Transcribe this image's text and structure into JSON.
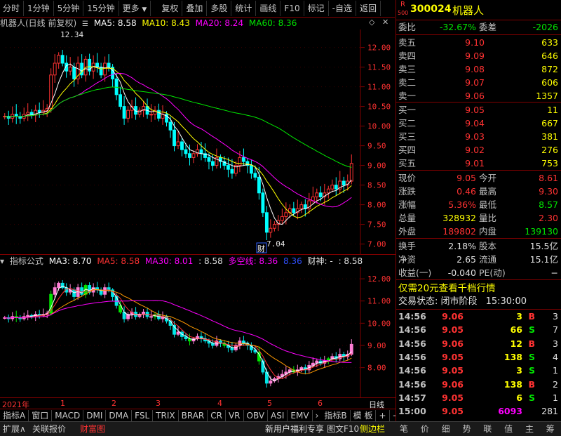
{
  "toolbar": {
    "items": [
      "分时",
      "1分钟",
      "5分钟",
      "15分钟",
      "更多",
      "复权",
      "叠加",
      "多股",
      "统计",
      "画线",
      "F10",
      "标记",
      "-自选",
      "返回"
    ],
    "symbol_icon": "down-arrow-icon"
  },
  "main_chart": {
    "title": "机器人(日线 前复权)",
    "ma5": "MA5: 8.58",
    "ma10": "MA10: 8.43",
    "ma20": "MA20: 8.24",
    "ma60": "MA60: 8.36",
    "high_label": "12.34",
    "low_label": "7.04",
    "cai_tag": "财",
    "y_ticks": [
      "12.00",
      "11.50",
      "11.00",
      "10.50",
      "10.00",
      "9.50",
      "9.00",
      "8.50",
      "8.00",
      "7.50",
      "7.00"
    ]
  },
  "sub_chart": {
    "title": "指标公式",
    "ma3": "MA3: 8.70",
    "ma5": "MA5: 8.58",
    "ma30": "MA30: 8.01",
    "v1": ": 8.58",
    "dkx": "多空线: 8.36",
    "v2": "8.36",
    "cs": "财神: -",
    "v3": ": 8.58",
    "y_ticks": [
      "12.00",
      "11.00",
      "10.00",
      "9.00",
      "8.00"
    ]
  },
  "time_axis": {
    "labels": [
      "2021年",
      "1",
      "2",
      "3",
      "4",
      "5",
      "6"
    ],
    "period": "日线"
  },
  "bottom_tabs": [
    "指标A",
    "窗口",
    "MACD",
    "DMI",
    "DMA",
    "FSL",
    "TRIX",
    "BRAR",
    "CR",
    "VR",
    "OBV",
    "ASI",
    "EMV"
  ],
  "bottom_tabs_right": [
    "指标B",
    "模 板",
    "+",
    "−"
  ],
  "status_bar": {
    "left": [
      "扩展∧",
      "关联报价",
      "财富图"
    ],
    "ad": "新用户福利专享",
    "f10": "图文F10",
    "side": "侧边栏",
    "tabs": [
      "笔",
      "价",
      "细",
      "势",
      "联",
      "值",
      "主",
      "筹"
    ]
  },
  "quote": {
    "code": "300024",
    "name": "机器人",
    "badge_r": "R",
    "badge_num": "500",
    "weibi_label": "委比",
    "weibi": "-32.67%",
    "weicha_label": "委差",
    "weicha": "-2026",
    "sells": [
      {
        "label": "卖五",
        "price": "9.10",
        "vol": "633"
      },
      {
        "label": "卖四",
        "price": "9.09",
        "vol": "646"
      },
      {
        "label": "卖三",
        "price": "9.08",
        "vol": "872"
      },
      {
        "label": "卖二",
        "price": "9.07",
        "vol": "606"
      },
      {
        "label": "卖一",
        "price": "9.06",
        "vol": "1357"
      }
    ],
    "buys": [
      {
        "label": "买一",
        "price": "9.05",
        "vol": "11"
      },
      {
        "label": "买二",
        "price": "9.04",
        "vol": "667"
      },
      {
        "label": "买三",
        "price": "9.03",
        "vol": "381"
      },
      {
        "label": "买四",
        "price": "9.02",
        "vol": "276"
      },
      {
        "label": "买五",
        "price": "9.01",
        "vol": "753"
      }
    ],
    "stats": [
      {
        "l1": "现价",
        "v1": "9.05",
        "c1": "red",
        "l2": "今开",
        "v2": "8.61",
        "c2": "red"
      },
      {
        "l1": "涨跌",
        "v1": "0.46",
        "c1": "red",
        "l2": "最高",
        "v2": "9.30",
        "c2": "red"
      },
      {
        "l1": "涨幅",
        "v1": "5.36%",
        "c1": "red",
        "l2": "最低",
        "v2": "8.57",
        "c2": "grn"
      },
      {
        "l1": "总量",
        "v1": "328932",
        "c1": "yel",
        "l2": "量比",
        "v2": "2.30",
        "c2": "red"
      },
      {
        "l1": "外盘",
        "v1": "189802",
        "c1": "red",
        "l2": "内盘",
        "v2": "139130",
        "c2": "grn"
      }
    ],
    "stats2": [
      {
        "l1": "换手",
        "v1": "2.18%",
        "l2": "股本",
        "v2": "15.5亿"
      },
      {
        "l1": "净资",
        "v1": "2.65",
        "l2": "流通",
        "v2": "15.1亿"
      },
      {
        "l1": "收益(一)",
        "v1": "-0.040",
        "l2": "PE(动)",
        "v2": "−"
      }
    ],
    "promo": "仅需20元查看千档行情",
    "trade_state_label": "交易状态: 闭市阶段",
    "trade_time": "15:30:00",
    "ticks": [
      {
        "t": "14:56",
        "p": "9.06",
        "v": "3",
        "s": "B",
        "n": "3"
      },
      {
        "t": "14:56",
        "p": "9.05",
        "v": "66",
        "s": "S",
        "n": "7"
      },
      {
        "t": "14:56",
        "p": "9.06",
        "v": "12",
        "s": "B",
        "n": "3"
      },
      {
        "t": "14:56",
        "p": "9.05",
        "v": "138",
        "s": "S",
        "n": "4"
      },
      {
        "t": "14:56",
        "p": "9.05",
        "v": "3",
        "s": "S",
        "n": "1"
      },
      {
        "t": "14:56",
        "p": "9.06",
        "v": "138",
        "s": "B",
        "n": "2"
      },
      {
        "t": "14:57",
        "p": "9.05",
        "v": "6",
        "s": "S",
        "n": "1"
      },
      {
        "t": "15:00",
        "p": "9.05",
        "v": "6093",
        "s": "",
        "n": "281"
      }
    ]
  },
  "chart_data": {
    "type": "candlestick",
    "y_range": [
      6.85,
      12.35
    ],
    "points": [
      10.25,
      10.2,
      10.3,
      10.25,
      10.2,
      10.3,
      10.35,
      10.3,
      10.4,
      10.35,
      10.4,
      10.45,
      11.3,
      11.6,
      11.8,
      11.6,
      11.4,
      11.5,
      11.2,
      11.6,
      11.3,
      11.7,
      11.4,
      11.6,
      11.5,
      11.3,
      11.6,
      11.5,
      11.2,
      10.8,
      10.5,
      10.2,
      10.4,
      10.5,
      10.3,
      10.4,
      10.5,
      10.3,
      10.3,
      10.4,
      10.2,
      10.3,
      10.1,
      9.9,
      9.5,
      9.6,
      9.4,
      9.3,
      9.2,
      9.3,
      9.4,
      9.3,
      9.2,
      9.1,
      9.0,
      9.2,
      9.1,
      9.0,
      8.9,
      8.8,
      9.0,
      9.2,
      9.1,
      9.0,
      8.8,
      8.7,
      8.3,
      7.8,
      7.3,
      7.4,
      7.5,
      7.6,
      7.7,
      7.8,
      7.9,
      7.8,
      7.9,
      8.0,
      7.9,
      8.1,
      8.2,
      8.3,
      8.2,
      8.3,
      8.4,
      8.5,
      8.4,
      8.6,
      8.5,
      8.6,
      9.05
    ]
  }
}
